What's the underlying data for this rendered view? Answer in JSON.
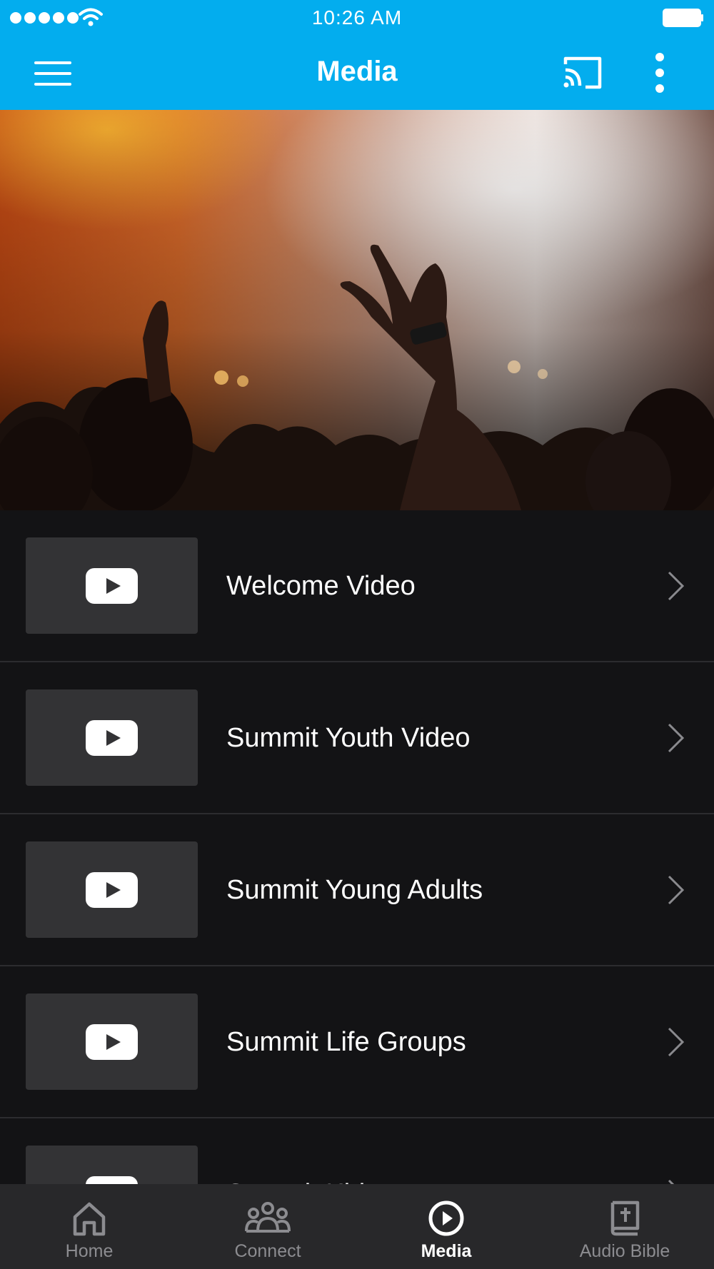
{
  "status_bar": {
    "time": "10:26 AM",
    "signal_icon": "signal-dots-icon",
    "wifi_icon": "wifi-icon",
    "battery_icon": "battery-icon"
  },
  "app_bar": {
    "title": "Media",
    "menu_icon": "hamburger-menu-icon",
    "cast_icon": "cast-icon",
    "more_icon": "more-vertical-icon"
  },
  "colors": {
    "accent": "#03ADEE",
    "background": "#131315",
    "thumbnail": "#333335",
    "nav_background": "#28282a",
    "nav_inactive": "#8c8c90",
    "nav_active": "#FFFFFF"
  },
  "media_list": {
    "items": [
      {
        "label": "Welcome Video",
        "icon": "youtube-play-icon"
      },
      {
        "label": "Summit Youth Video",
        "icon": "youtube-play-icon"
      },
      {
        "label": "Summit Young Adults",
        "icon": "youtube-play-icon"
      },
      {
        "label": "Summit Life Groups",
        "icon": "youtube-play-icon"
      },
      {
        "label": "Summit Kids",
        "icon": "youtube-play-icon"
      }
    ]
  },
  "bottom_nav": {
    "items": [
      {
        "label": "Home",
        "icon": "home-icon",
        "active": false
      },
      {
        "label": "Connect",
        "icon": "group-icon",
        "active": false
      },
      {
        "label": "Media",
        "icon": "play-circle-icon",
        "active": true
      },
      {
        "label": "Audio Bible",
        "icon": "bible-icon",
        "active": false
      }
    ]
  }
}
